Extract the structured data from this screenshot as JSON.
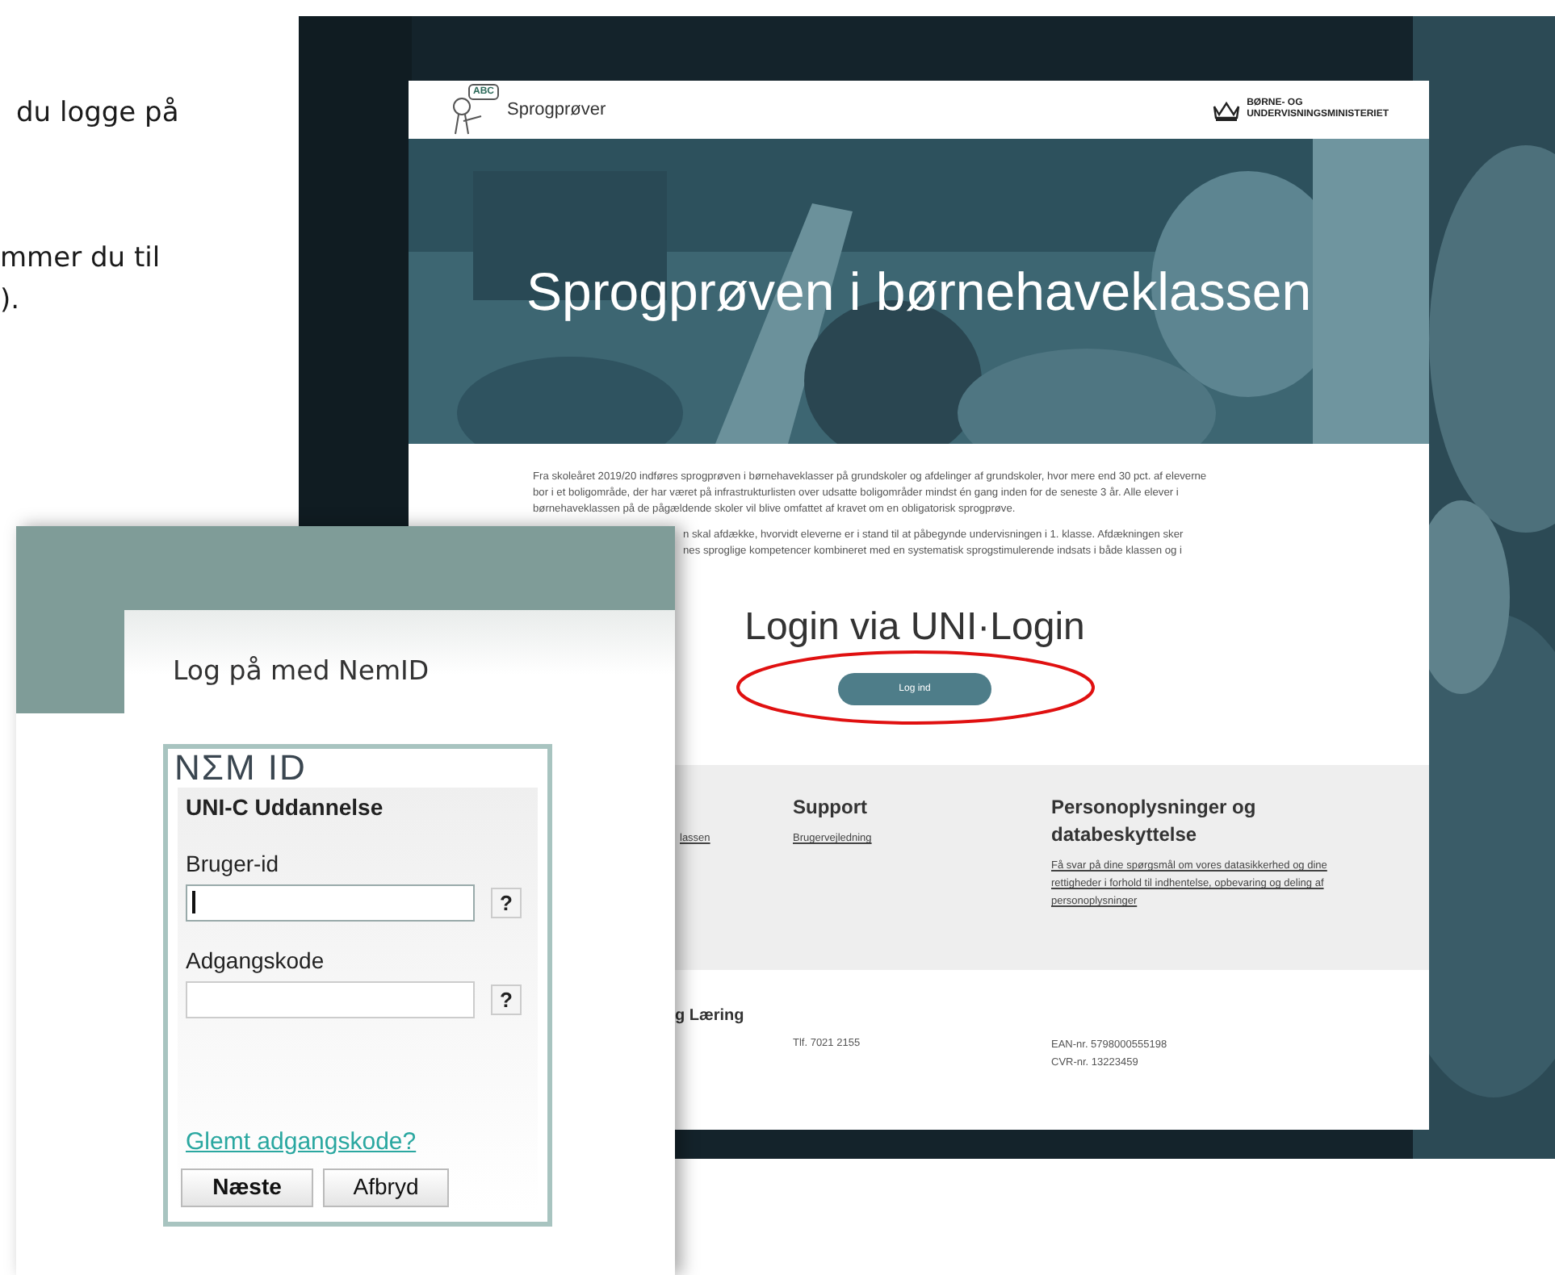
{
  "intro_lines": [
    "du logge på",
    "mmer du til",
    ")."
  ],
  "site": {
    "logo_badge": "ABC",
    "logo_text": "Sprogprøver",
    "ministry_lines": [
      "BØRNE- OG",
      "UNDERVISNINGSMINISTERIET"
    ],
    "hero_title": "Sprogprøven i børnehaveklassen",
    "paragraph_lines": [
      "Fra skoleåret 2019/20 indføres sprogprøven i børnehaveklasser på grundskoler og afdelinger af grundskoler, hvor mere end 30 pct. af eleverne",
      "bor i et boligområde, der har været på infrastrukturlisten over udsatte boligområder mindst én gang inden for de seneste 3 år. Alle elever i",
      "børnehaveklassen på de pågældende skoler vil blive omfattet af kravet om en obligatorisk sprogprøve."
    ],
    "paragraph2_lines": [
      "n skal afdække, hvorvidt eleverne er i stand til at påbegynde undervisningen i 1. klasse. Afdækningen sker",
      "nes sproglige kompetencer kombineret med en systematisk sprogstimulerende indsats i både klassen og i"
    ],
    "login_title": "Login via UNI·Login",
    "login_button": "Log ind",
    "footer_columns": [
      {
        "links": [
          "lassen"
        ]
      },
      {
        "heading": "Support",
        "links": [
          "Brugervejledning"
        ]
      },
      {
        "heading": "Personoplysninger og databeskyttelse",
        "links": [
          "Få svar på dine spørgsmål om vores datasikkerhed og dine rettigheder i forhold til indhentelse, opbevaring og deling af personoplysninger"
        ]
      }
    ],
    "contact": {
      "title": "g Læring",
      "phone": "Tlf. 7021 2155",
      "ids": [
        "EAN-nr. 5798000555198",
        "CVR-nr. 13223459"
      ]
    }
  },
  "nemid": {
    "heading": "Log på med NemID",
    "logo": "NΣM ID",
    "provider": "UNI-C Uddannelse",
    "fields": [
      {
        "label": "Bruger-id",
        "help": "?",
        "focused": true
      },
      {
        "label": "Adgangskode",
        "help": "?",
        "focused": false
      }
    ],
    "forgot_link": "Glemt adgangskode?",
    "buttons": [
      "Næste",
      "Afbryd"
    ]
  }
}
